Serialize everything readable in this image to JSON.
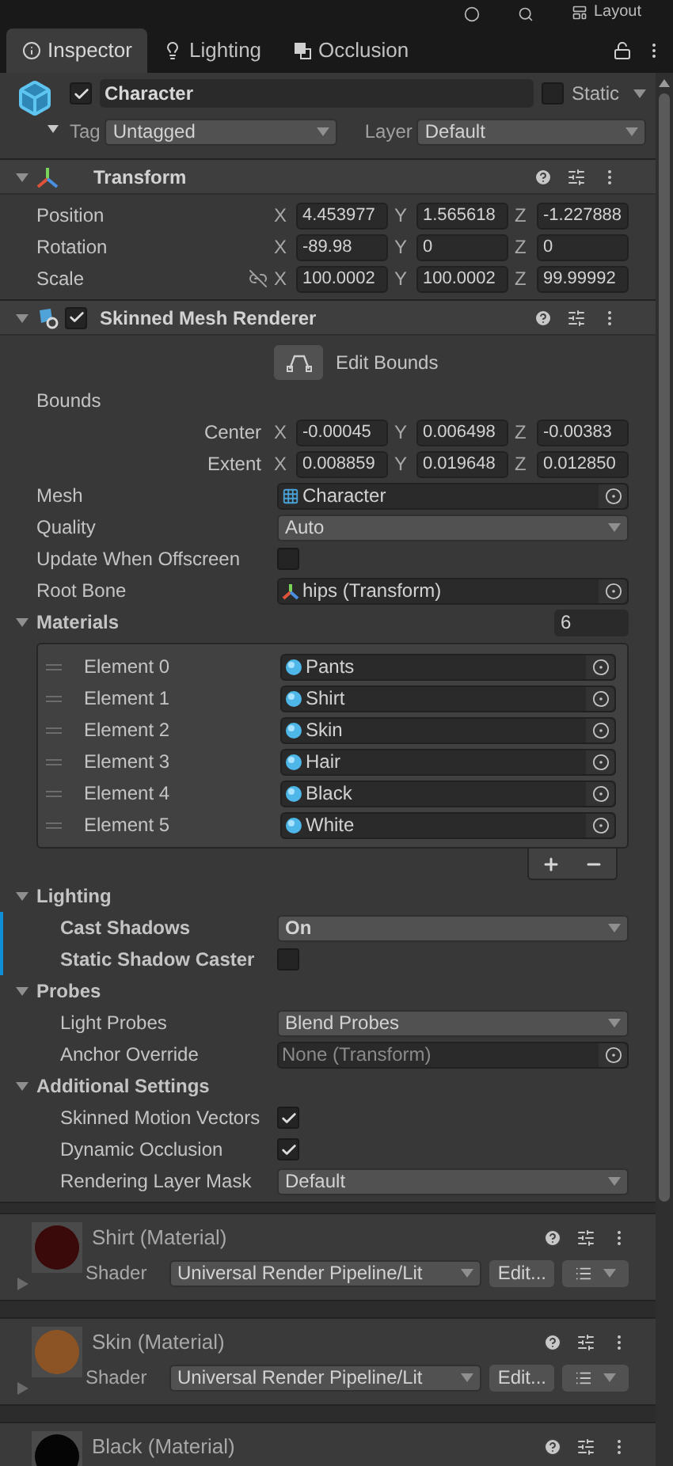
{
  "toolbar": {
    "layout_label": "Layout"
  },
  "tabs": [
    {
      "label": "Inspector",
      "selected": true
    },
    {
      "label": "Lighting",
      "selected": false
    },
    {
      "label": "Occlusion",
      "selected": false
    }
  ],
  "object": {
    "active": true,
    "name": "Character",
    "static": false,
    "static_label": "Static",
    "tag_label": "Tag",
    "tag": "Untagged",
    "layer_label": "Layer",
    "layer": "Default"
  },
  "components": [
    {
      "kind": "transform",
      "title": "Transform",
      "expanded": true,
      "rows": [
        {
          "kind": "vector3",
          "label": "Position",
          "values": [
            {
              "axis": "X",
              "value": "4.453977"
            },
            {
              "axis": "Y",
              "value": "1.565618"
            },
            {
              "axis": "Z",
              "value": "-1.227888"
            }
          ]
        },
        {
          "kind": "vector3",
          "label": "Rotation",
          "values": [
            {
              "axis": "X",
              "value": "-89.98"
            },
            {
              "axis": "Y",
              "value": "0"
            },
            {
              "axis": "Z",
              "value": "0"
            }
          ]
        },
        {
          "kind": "vector3",
          "label": "Scale",
          "constrain_proportions": false,
          "values": [
            {
              "axis": "X",
              "value": "100.0002"
            },
            {
              "axis": "Y",
              "value": "100.0002"
            },
            {
              "axis": "Z",
              "value": "99.99992"
            }
          ]
        }
      ]
    },
    {
      "kind": "renderer",
      "title": "Skinned Mesh Renderer",
      "enabled": true,
      "expanded": true,
      "rows": [
        {
          "kind": "button",
          "label": "Edit Bounds"
        },
        {
          "kind": "group",
          "label": "Bounds",
          "children": [
            {
              "kind": "vector3",
              "label": "Center",
              "values": [
                {
                  "axis": "X",
                  "value": "-0.00045"
                },
                {
                  "axis": "Y",
                  "value": "0.006498"
                },
                {
                  "axis": "Z",
                  "value": "-0.00383"
                }
              ]
            },
            {
              "kind": "vector3",
              "label": "Extent",
              "values": [
                {
                  "axis": "X",
                  "value": "0.008859"
                },
                {
                  "axis": "Y",
                  "value": "0.019648"
                },
                {
                  "axis": "Z",
                  "value": "0.012850"
                }
              ]
            }
          ]
        },
        {
          "kind": "mesh_reference",
          "label": "Mesh",
          "value": "Character"
        },
        {
          "kind": "dropdown",
          "label": "Quality",
          "value": "Auto"
        },
        {
          "kind": "checkbox",
          "label": "Update When Offscreen",
          "checked": false
        },
        {
          "kind": "transform_reference",
          "label": "Root Bone",
          "value": "hips (Transform)"
        },
        {
          "kind": "array",
          "label": "Materials",
          "count": "6",
          "expanded": true,
          "elements": [
            {
              "label": "Element 0",
              "value": "Pants"
            },
            {
              "label": "Element 1",
              "value": "Shirt"
            },
            {
              "label": "Element 2",
              "value": "Skin"
            },
            {
              "label": "Element 3",
              "value": "Hair"
            },
            {
              "label": "Element 4",
              "value": "Black"
            },
            {
              "label": "Element 5",
              "value": "White"
            }
          ]
        },
        {
          "kind": "section",
          "label": "Lighting",
          "expanded": true,
          "children": [
            {
              "kind": "dropdown",
              "label": "Cast Shadows",
              "value": "On",
              "modified": true
            },
            {
              "kind": "checkbox",
              "label": "Static Shadow Caster",
              "checked": false,
              "modified": true
            }
          ]
        },
        {
          "kind": "section",
          "label": "Probes",
          "expanded": true,
          "children": [
            {
              "kind": "dropdown",
              "label": "Light Probes",
              "value": "Blend Probes"
            },
            {
              "kind": "reference",
              "label": "Anchor Override",
              "placeholder": "None (Transform)"
            }
          ]
        },
        {
          "kind": "section",
          "label": "Additional Settings",
          "expanded": true,
          "children": [
            {
              "kind": "checkbox",
              "label": "Skinned Motion Vectors",
              "checked": true
            },
            {
              "kind": "checkbox",
              "label": "Dynamic Occlusion",
              "checked": true
            },
            {
              "kind": "dropdown",
              "label": "Rendering Layer Mask",
              "value": "Default"
            }
          ]
        }
      ]
    }
  ],
  "materials": [
    {
      "title": "Shirt (Material)",
      "color": "#3a0909",
      "shader_label": "Shader",
      "shader": "Universal Render Pipeline/Lit",
      "edit": "Edit..."
    },
    {
      "title": "Skin (Material)",
      "color": "#8c5424",
      "shader_label": "Shader",
      "shader": "Universal Render Pipeline/Lit",
      "edit": "Edit..."
    },
    {
      "title": "Black (Material)",
      "color": "#050505"
    }
  ]
}
